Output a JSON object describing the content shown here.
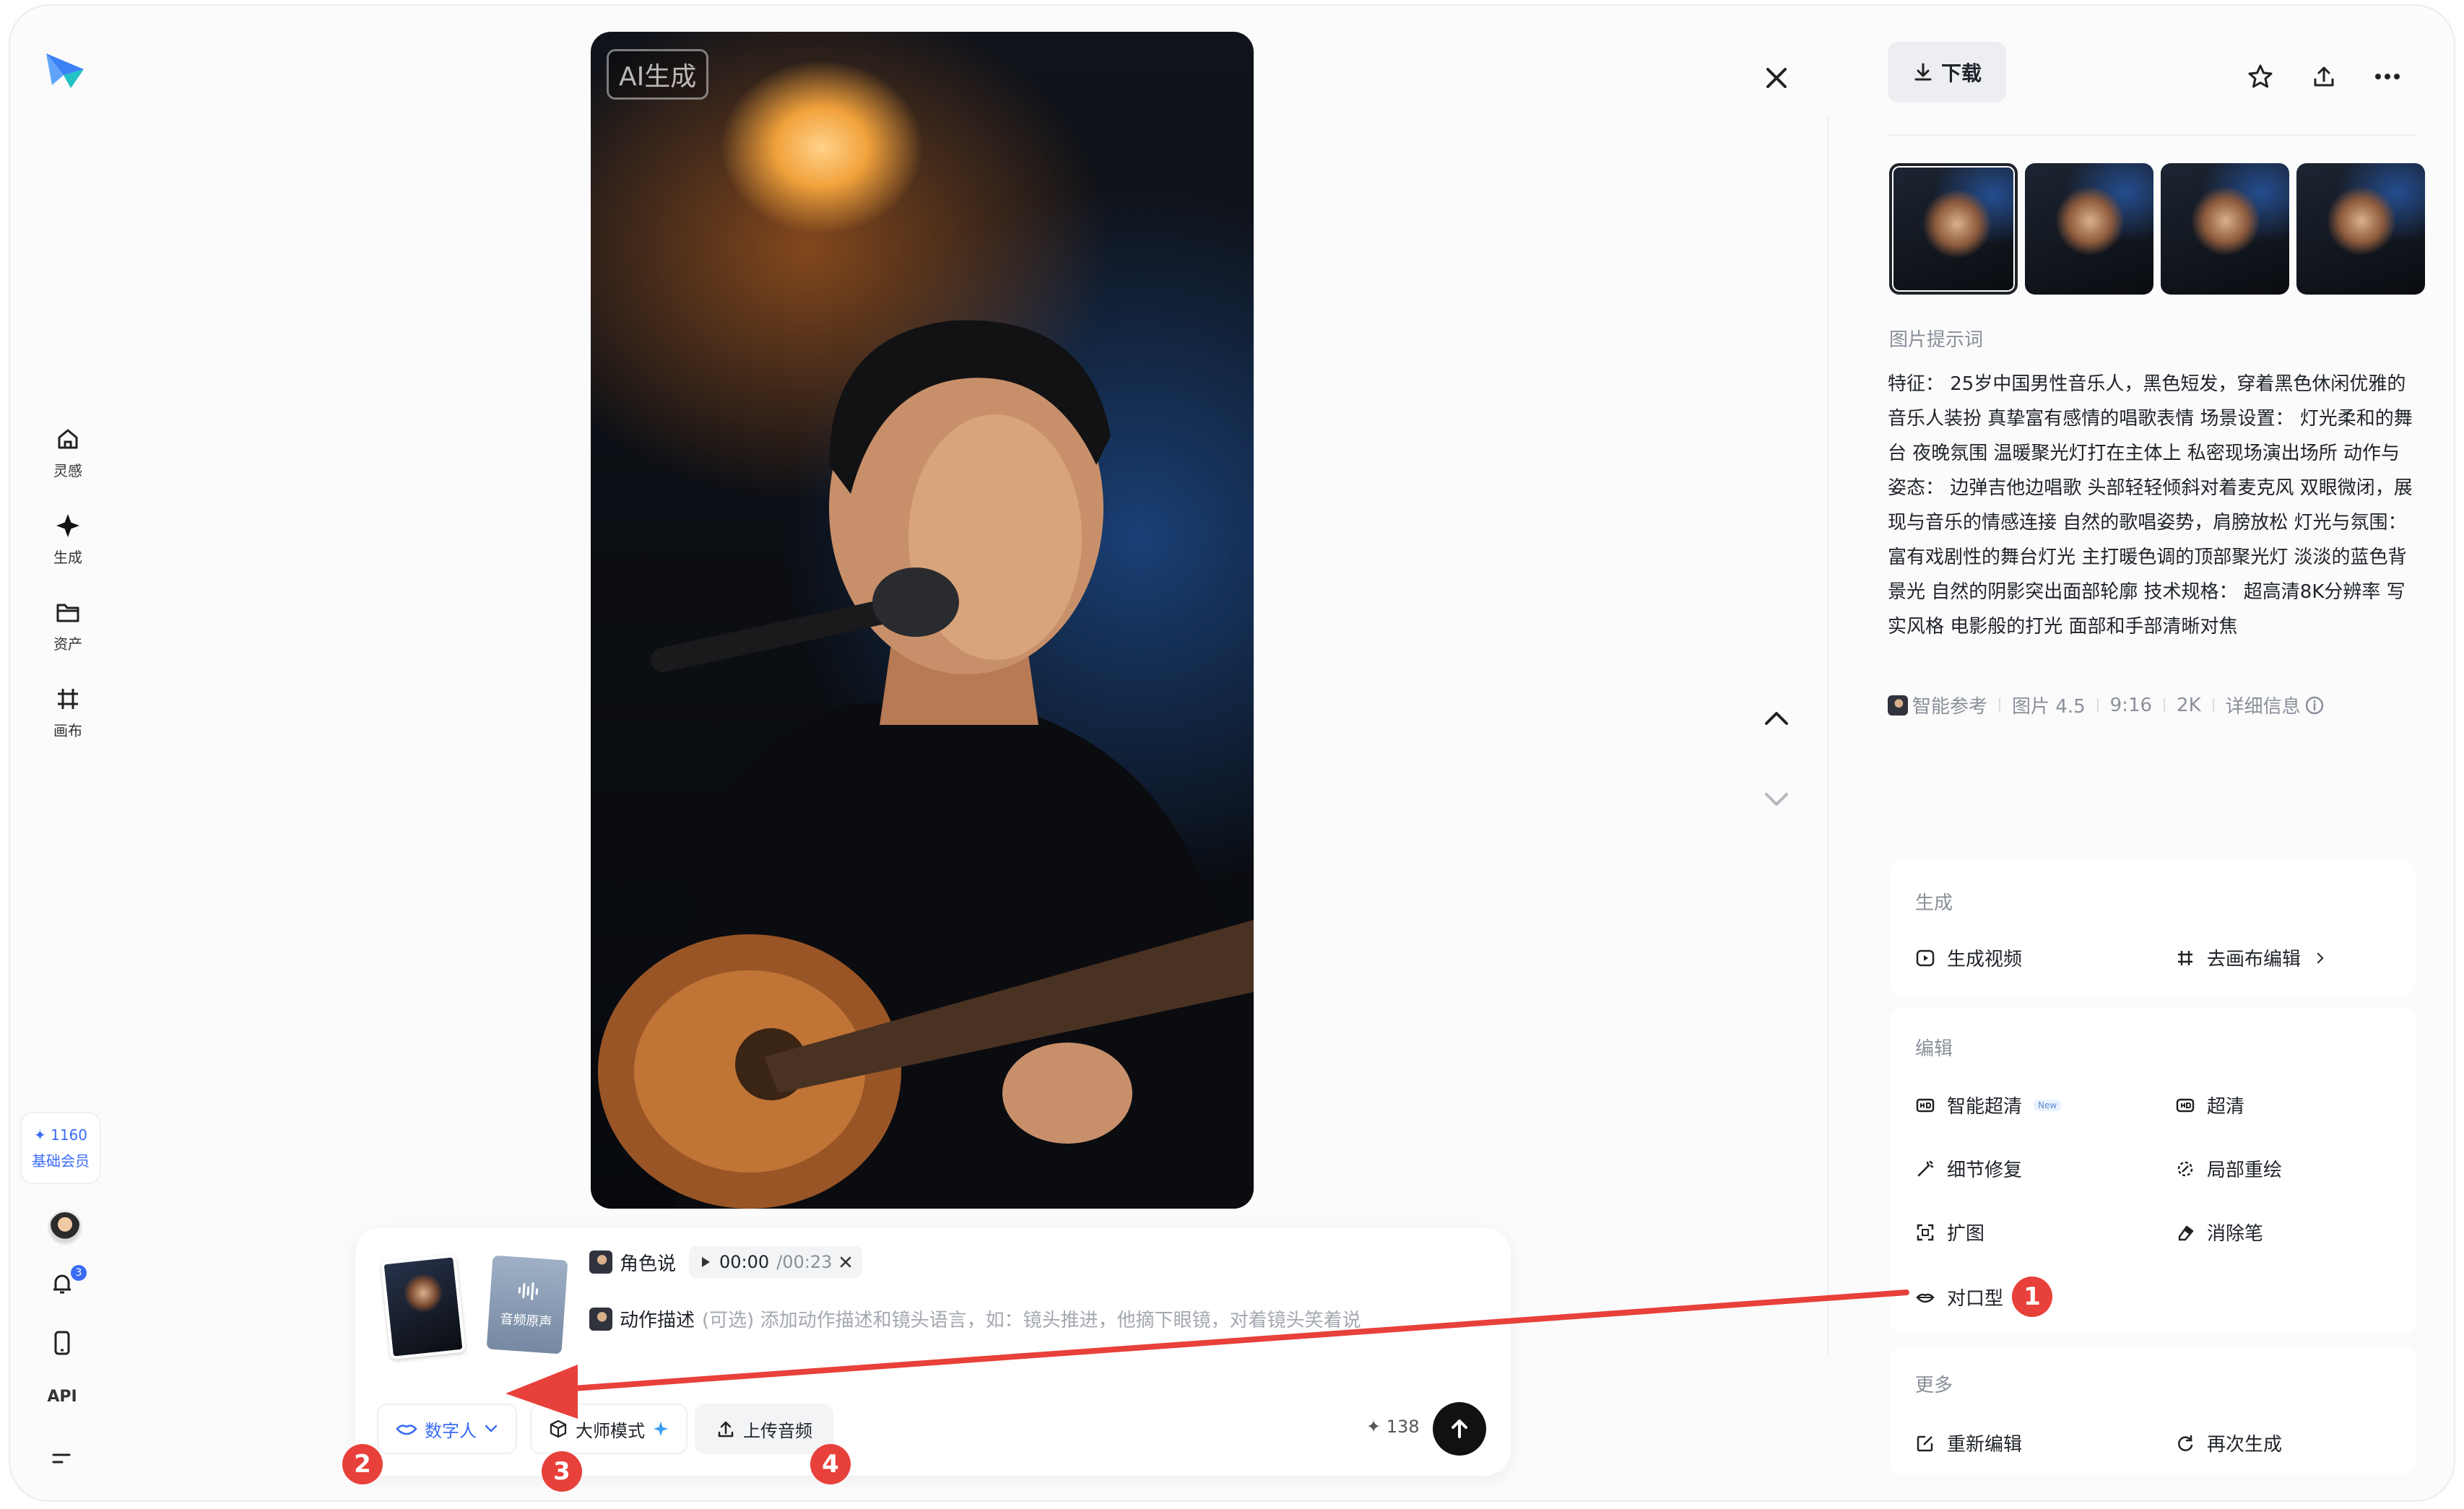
{
  "image": {
    "ai_tag": "AI生成"
  },
  "sidebar": {
    "items": [
      {
        "label": "灵感"
      },
      {
        "label": "生成"
      },
      {
        "label": "资产"
      },
      {
        "label": "画布"
      }
    ],
    "credits": "✦ 1160",
    "tier": "基础会员",
    "notification_count": "3",
    "api_label": "API"
  },
  "right_panel": {
    "download_label": "下载",
    "prompt_label": "图片提示词",
    "prompt_text": "特征： 25岁中国男性音乐人，黑色短发，穿着黑色休闲优雅的音乐人装扮 真挚富有感情的唱歌表情 场景设置： 灯光柔和的舞台 夜晚氛围 温暖聚光灯打在主体上 私密现场演出场所 动作与姿态： 边弹吉他边唱歌 头部轻轻倾斜对着麦克风 双眼微闭，展现与音乐的情感连接 自然的歌唱姿势，肩膀放松 灯光与氛围： 富有戏剧性的舞台灯光 主打暖色调的顶部聚光灯 淡淡的蓝色背景光 自然的阴影突出面部轮廓 技术规格： 超高清8K分辨率 写实风格 电影般的打光 面部和手部清晰对焦",
    "meta": [
      "智能参考",
      "图片 4.5",
      "9:16",
      "2K",
      "详细信息"
    ],
    "generate": {
      "title": "生成",
      "items": [
        "生成视频",
        "去画布编辑"
      ]
    },
    "edit": {
      "title": "编辑",
      "items": [
        "智能超清",
        "超清",
        "细节修复",
        "局部重绘",
        "扩图",
        "消除笔",
        "对口型"
      ],
      "new_tag": "New"
    },
    "more": {
      "title": "更多",
      "items": [
        "重新编辑",
        "再次生成"
      ]
    }
  },
  "composer": {
    "audio_card_label": "音频原声",
    "line1_label": "角色说",
    "time_current": "00:00",
    "time_total": "/00:23",
    "line2_label": "动作描述",
    "line2_placeholder": "(可选) 添加动作描述和镜头语言，如：镜头推进，他摘下眼镜，对着镜头笑着说",
    "chip_digital": "数字人",
    "chip_master": "大师模式",
    "chip_upload": "上传音频",
    "cost": "✦ 138"
  },
  "annotations": {
    "badges": [
      "1",
      "2",
      "3",
      "4"
    ],
    "color": "#e8403a"
  }
}
